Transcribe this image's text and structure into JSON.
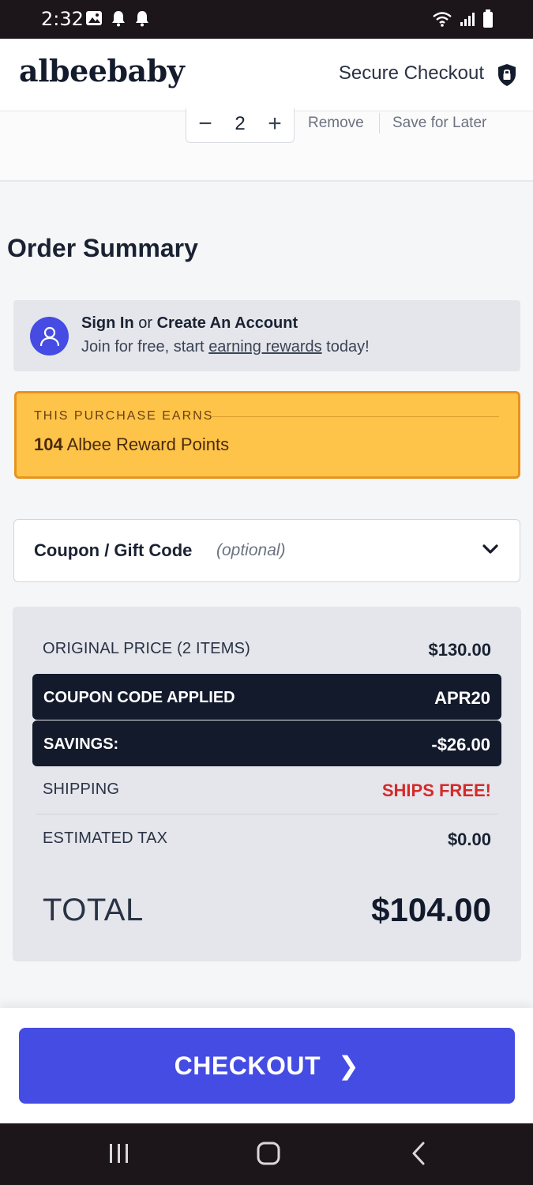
{
  "status_bar": {
    "time": "2:32"
  },
  "header": {
    "logo": "albeebaby",
    "secure_label": "Secure Checkout"
  },
  "cart_item": {
    "quantity": "2",
    "minus_label": "−",
    "plus_label": "+",
    "remove_label": "Remove",
    "save_later_label": "Save for Later"
  },
  "order_summary": {
    "title": "Order Summary",
    "signin": {
      "sign_in": "Sign In",
      "or": "or",
      "create_account": "Create An Account",
      "join_prefix": "Join for free, start",
      "earning_rewards": "earning rewards",
      "join_suffix": "today!"
    },
    "rewards": {
      "eyebrow": "THIS PURCHASE EARNS",
      "points": "104",
      "points_label": "Albee Reward Points"
    },
    "coupon": {
      "label": "Coupon / Gift Code",
      "optional": "(optional)"
    },
    "prices": {
      "original_label": "ORIGINAL PRICE (2 ITEMS)",
      "original_value": "$130.00",
      "coupon_label": "COUPON CODE APPLIED",
      "coupon_value": "APR20",
      "savings_label": "SAVINGS:",
      "savings_value": "-$26.00",
      "shipping_label": "SHIPPING",
      "shipping_value": "SHIPS FREE!",
      "tax_label": "ESTIMATED TAX",
      "tax_value": "$0.00",
      "total_label": "TOTAL",
      "total_value": "$104.00"
    }
  },
  "checkout": {
    "label": "CHECKOUT",
    "arrow": "❯"
  },
  "colors": {
    "brand_blue": "#444ce3",
    "rewards_yellow": "#fdc449",
    "dark_navy": "#131a2c",
    "ships_free_red": "#d42a2a"
  }
}
